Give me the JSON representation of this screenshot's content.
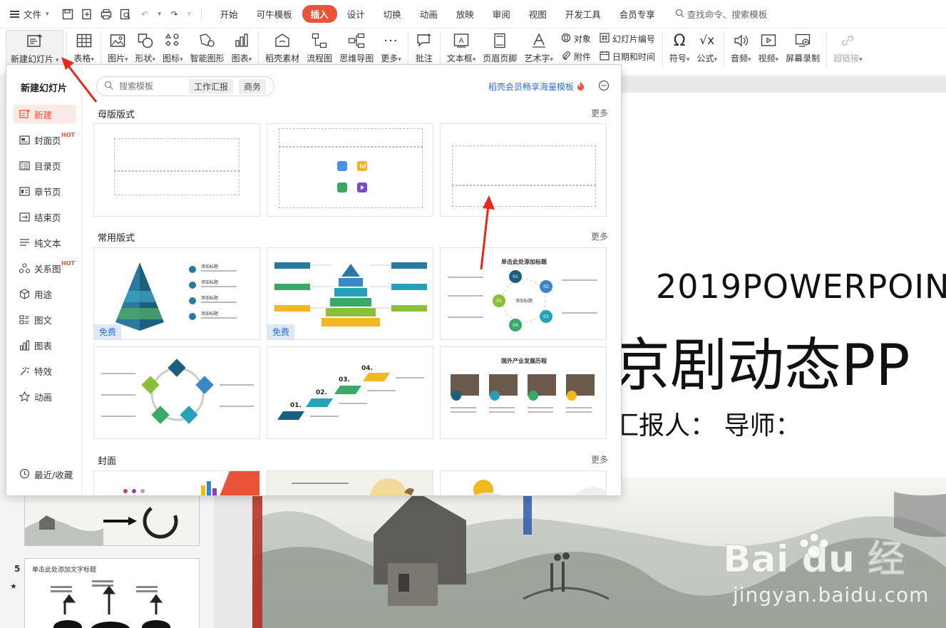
{
  "menubar": {
    "file_label": "文件",
    "tabs": [
      {
        "label": "开始",
        "active": false
      },
      {
        "label": "可牛模板",
        "active": false
      },
      {
        "label": "插入",
        "active": true
      },
      {
        "label": "设计",
        "active": false
      },
      {
        "label": "切换",
        "active": false
      },
      {
        "label": "动画",
        "active": false
      },
      {
        "label": "放映",
        "active": false
      },
      {
        "label": "审阅",
        "active": false
      },
      {
        "label": "视图",
        "active": false
      },
      {
        "label": "开发工具",
        "active": false
      },
      {
        "label": "会员专享",
        "active": false
      }
    ],
    "search_label": "查找命令、搜索模板"
  },
  "ribbon": {
    "new_slide": "新建幻灯片",
    "table": "表格",
    "picture": "图片",
    "shape": "形状",
    "icon": "图标",
    "smart_graphic": "智能图形",
    "chart": "图表",
    "daoke_material": "稻壳素材",
    "flowchart": "流程图",
    "mindmap": "思维导图",
    "more": "更多",
    "comment": "批注",
    "textbox": "文本框",
    "header_footer": "页眉页脚",
    "wordart": "艺术字",
    "object": "对象",
    "attachment": "附件",
    "slide_number": "幻灯片编号",
    "date_time": "日期和时间",
    "symbol": "符号",
    "formula": "公式",
    "audio": "音频",
    "video": "视频",
    "screen_record": "屏幕录制",
    "hyperlink": "超链接"
  },
  "panel": {
    "heading": "新建幻灯片",
    "search_placeholder": "搜索模板",
    "tags": [
      "工作汇报",
      "商务"
    ],
    "promo": "稻壳会员畅享海量模板",
    "hot_badge": "HOT",
    "categories": [
      {
        "label": "新建",
        "icon": "new-slide-icon",
        "selected": true
      },
      {
        "label": "封面页",
        "icon": "cover-icon",
        "hot": true
      },
      {
        "label": "目录页",
        "icon": "toc-icon"
      },
      {
        "label": "章节页",
        "icon": "chapter-icon"
      },
      {
        "label": "结束页",
        "icon": "end-page-icon"
      },
      {
        "label": "纯文本",
        "icon": "text-lines-icon"
      },
      {
        "label": "关系图",
        "icon": "relation-icon",
        "hot": true
      },
      {
        "label": "用途",
        "icon": "cube-icon"
      },
      {
        "label": "图文",
        "icon": "image-text-icon"
      },
      {
        "label": "图表",
        "icon": "bar-chart-icon"
      },
      {
        "label": "特效",
        "icon": "effects-icon"
      },
      {
        "label": "动画",
        "icon": "star-icon"
      }
    ],
    "recent_label": "最近/收藏",
    "sections": {
      "master": {
        "title": "母版版式",
        "more": "更多"
      },
      "common": {
        "title": "常用版式",
        "more": "更多"
      },
      "cover": {
        "title": "封面",
        "more": "更多"
      }
    },
    "free_badge": "免费",
    "template_texts": {
      "add_title": "添加标题",
      "cycle_title": "单击此处添加标题",
      "history_title": "国外产业发展历程",
      "steps": [
        "01.",
        "02.",
        "03.",
        "04."
      ],
      "cycle_nums": [
        "01",
        "02",
        "03",
        "04",
        "05"
      ]
    }
  },
  "slide": {
    "subtitle": "2019POWERPOIN",
    "title": "京剧动态PP",
    "reporter": "汇报人： 导师：",
    "thumb_number": "5",
    "thumb_title": "单击此处添加文字标题"
  },
  "watermark": {
    "text": "jingyan.baidu.com",
    "logo_text": "Bai du 经验"
  },
  "colors": {
    "accent": "#e9533a",
    "link": "#2f6fd0",
    "arrow": "#e8261c"
  }
}
